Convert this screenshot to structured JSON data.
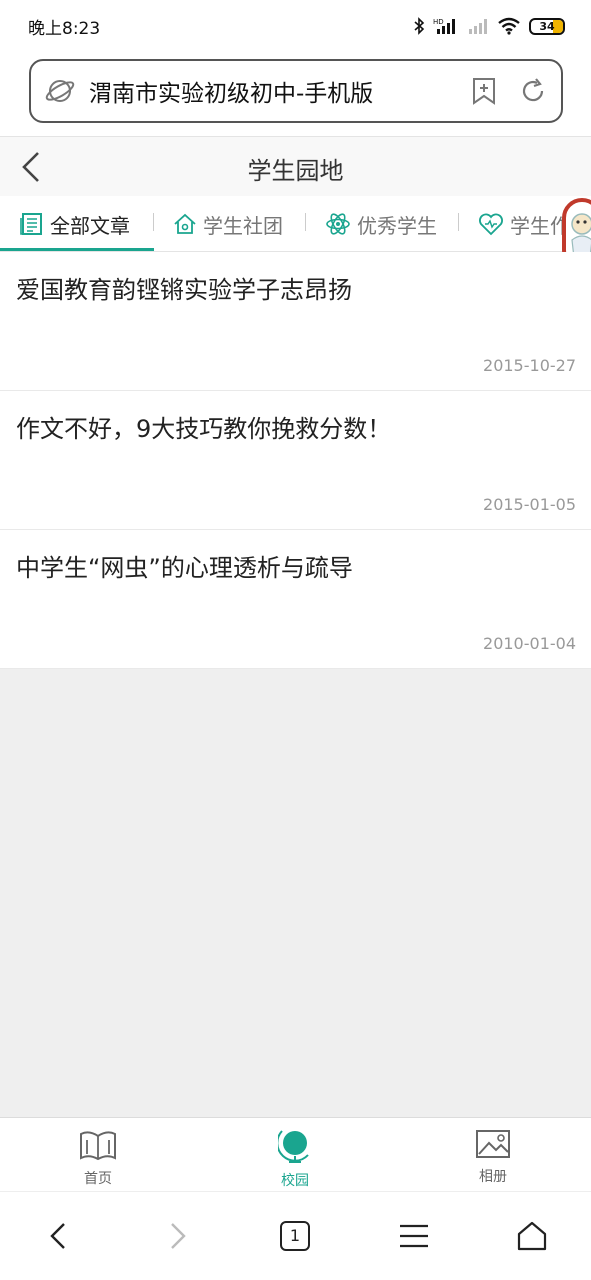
{
  "status_bar": {
    "time": "晚上8:23",
    "battery": "34"
  },
  "browser": {
    "url_title": "渭南市实验初级初中-手机版",
    "tab_count": "1"
  },
  "page": {
    "title": "学生园地"
  },
  "tabs": [
    {
      "label": "全部文章",
      "icon": "newspaper-icon"
    },
    {
      "label": "学生社团",
      "icon": "house-icon"
    },
    {
      "label": "优秀学生",
      "icon": "atom-icon"
    },
    {
      "label": "学生作",
      "icon": "heart-icon"
    }
  ],
  "articles": [
    {
      "title": "爱国教育韵铿锵实验学子志昂扬",
      "date": "2015-10-27"
    },
    {
      "title": "作文不好，9大技巧教你挽救分数！",
      "date": "2015-01-05"
    },
    {
      "title": "中学生“网虫”的心理透析与疏导",
      "date": "2010-01-04"
    }
  ],
  "bottom_nav": [
    {
      "label": "首页",
      "icon": "book-icon"
    },
    {
      "label": "校园",
      "icon": "globe-icon"
    },
    {
      "label": "相册",
      "icon": "image-icon"
    }
  ],
  "colors": {
    "accent": "#1aa58f",
    "date": "#999999",
    "background": "#efefef"
  }
}
